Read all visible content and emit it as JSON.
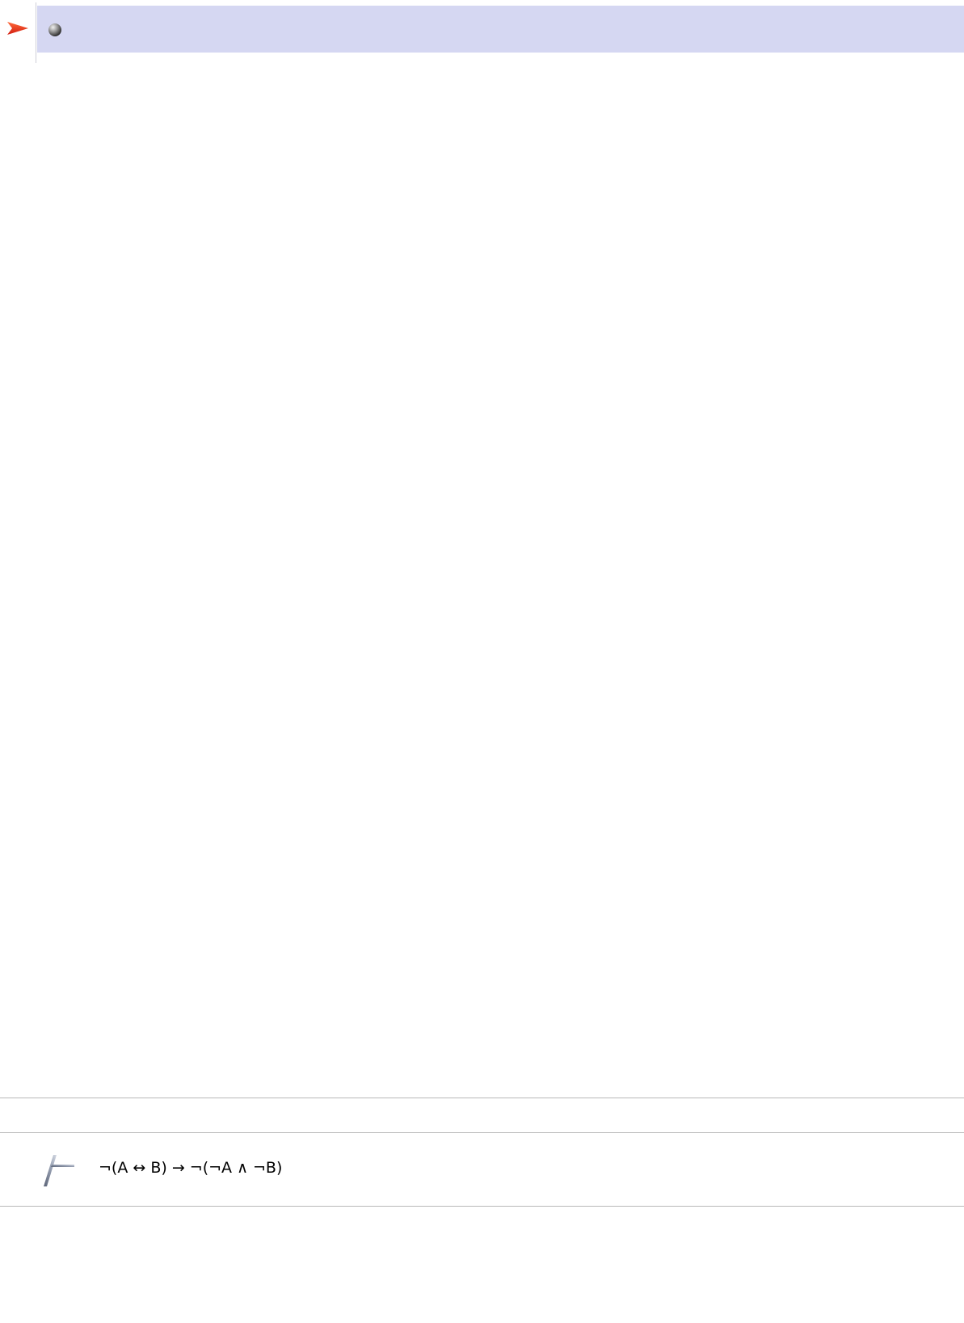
{
  "editor": {
    "current_line_marker_icon": "right-arrow-icon",
    "input_bullet_icon": "gray-ball-icon",
    "input_text": "",
    "highlight_color": "#d5d7f2",
    "arrow_color": "#e8331c"
  },
  "result": {
    "turnstile_icon": "turnstile-icon",
    "theorem_text": "¬(A ↔ B) → ¬(¬A ∧ ¬B)"
  }
}
